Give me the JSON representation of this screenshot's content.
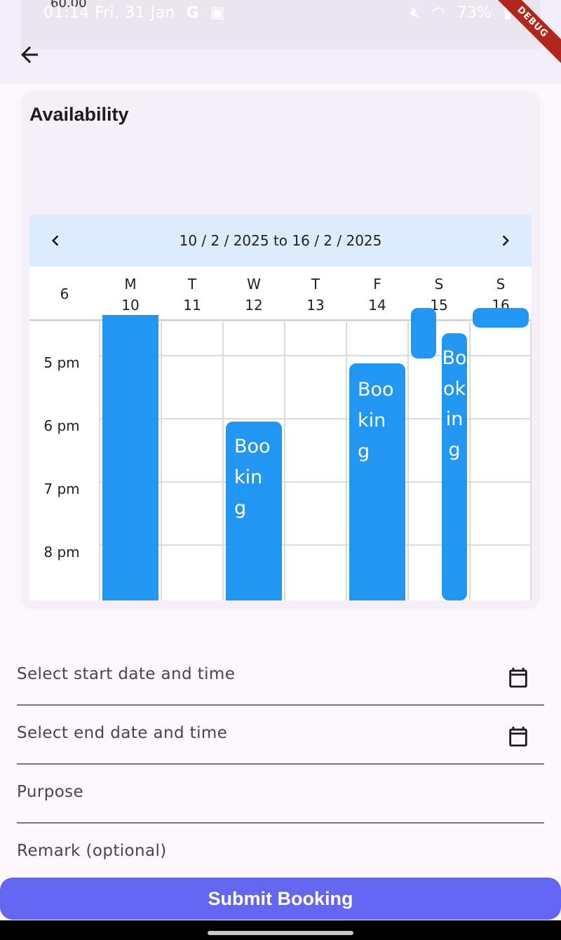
{
  "status_bar": {
    "fps": "60.00",
    "time": "01:14",
    "date": "Fri, 31 Jan",
    "left_icons": [
      "google-icon",
      "gallery-icon"
    ],
    "right_icons": [
      "mute-icon",
      "wifi-icon",
      "battery-icon"
    ],
    "battery": "73%",
    "debug_banner": "DEBUG"
  },
  "app_bar": {
    "back_icon": "arrow-left-icon"
  },
  "availability": {
    "title": "Availability",
    "calendar": {
      "range": "10 / 2 / 2025 to 16 / 2 / 2025",
      "week_number": "6",
      "days": [
        {
          "letter": "M",
          "date": "10"
        },
        {
          "letter": "T",
          "date": "11"
        },
        {
          "letter": "W",
          "date": "12"
        },
        {
          "letter": "T",
          "date": "13"
        },
        {
          "letter": "F",
          "date": "14"
        },
        {
          "letter": "S",
          "date": "15"
        },
        {
          "letter": "S",
          "date": "16"
        }
      ],
      "hours": [
        "5 pm",
        "6 pm",
        "7 pm",
        "8 pm"
      ],
      "booking_label": "Booking",
      "booking_color": "#2196f3",
      "header_color": "#dcecfc"
    }
  },
  "form": {
    "start_label": "Select start date and time",
    "end_label": "Select end date and time",
    "purpose_label": "Purpose",
    "remark_label": "Remark (optional)",
    "submit_label": "Submit Booking",
    "submit_color": "#6366f1"
  }
}
